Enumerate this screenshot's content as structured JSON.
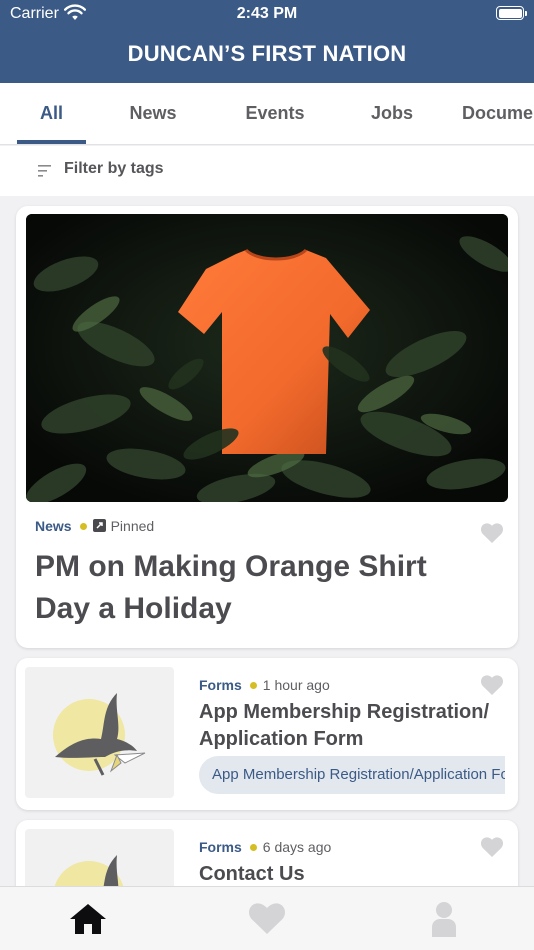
{
  "status_bar": {
    "carrier": "Carrier",
    "time": "2:43 PM"
  },
  "header": {
    "title": "DUNCAN’S FIRST NATION"
  },
  "tabs": [
    {
      "label": "All",
      "active": true
    },
    {
      "label": "News",
      "active": false
    },
    {
      "label": "Events",
      "active": false
    },
    {
      "label": "Jobs",
      "active": false
    },
    {
      "label": "Documents",
      "active": false
    }
  ],
  "filter": {
    "label": "Filter by tags",
    "icon": "filter-lines-icon"
  },
  "feed": [
    {
      "category": "News",
      "status": "Pinned",
      "title": "PM on Making Orange Shirt Day a Holiday",
      "image": "orange-shirt-in-foliage-photo",
      "favorited": false
    },
    {
      "category": "Forms",
      "time": "1 hour ago",
      "title": "App Membership Registration/ Application Form",
      "tag": "App Membership Registration/Application Form",
      "image": "eagle-logo-thumbnail",
      "favorited": false
    },
    {
      "category": "Forms",
      "time": "6 days ago",
      "title": "Contact Us",
      "image": "eagle-logo-thumbnail",
      "favorited": false
    }
  ],
  "bottom_nav": [
    {
      "name": "home",
      "icon": "home-icon",
      "active": true
    },
    {
      "name": "favorites",
      "icon": "heart-icon",
      "active": false
    },
    {
      "name": "profile",
      "icon": "person-icon",
      "active": false
    }
  ],
  "colors": {
    "brand": "#3b5a86",
    "accent_dot": "#d4be24",
    "tag_chip_bg": "#e3e8ef",
    "icon_inactive": "#d4d4d6"
  }
}
